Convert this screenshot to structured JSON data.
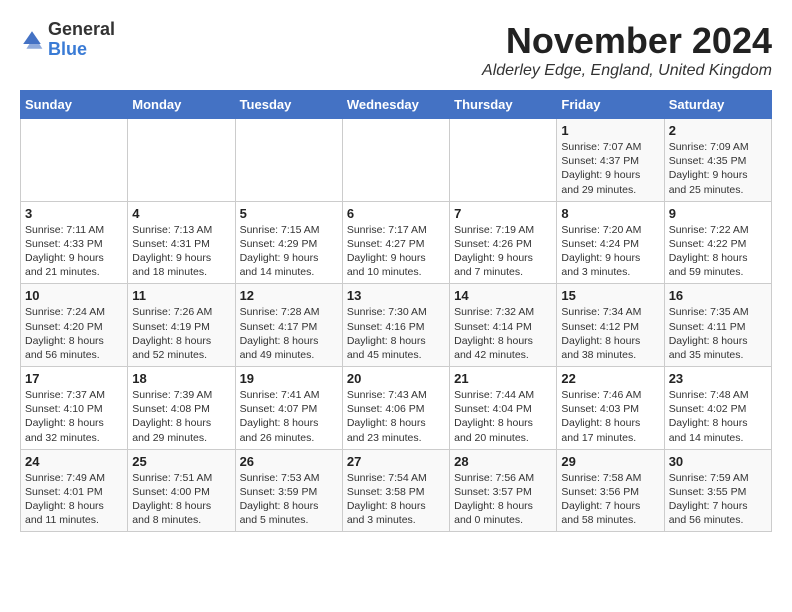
{
  "header": {
    "logo_general": "General",
    "logo_blue": "Blue",
    "title": "November 2024",
    "location": "Alderley Edge, England, United Kingdom"
  },
  "days_of_week": [
    "Sunday",
    "Monday",
    "Tuesday",
    "Wednesday",
    "Thursday",
    "Friday",
    "Saturday"
  ],
  "weeks": [
    [
      {
        "day": "",
        "info": ""
      },
      {
        "day": "",
        "info": ""
      },
      {
        "day": "",
        "info": ""
      },
      {
        "day": "",
        "info": ""
      },
      {
        "day": "",
        "info": ""
      },
      {
        "day": "1",
        "info": "Sunrise: 7:07 AM\nSunset: 4:37 PM\nDaylight: 9 hours and 29 minutes."
      },
      {
        "day": "2",
        "info": "Sunrise: 7:09 AM\nSunset: 4:35 PM\nDaylight: 9 hours and 25 minutes."
      }
    ],
    [
      {
        "day": "3",
        "info": "Sunrise: 7:11 AM\nSunset: 4:33 PM\nDaylight: 9 hours and 21 minutes."
      },
      {
        "day": "4",
        "info": "Sunrise: 7:13 AM\nSunset: 4:31 PM\nDaylight: 9 hours and 18 minutes."
      },
      {
        "day": "5",
        "info": "Sunrise: 7:15 AM\nSunset: 4:29 PM\nDaylight: 9 hours and 14 minutes."
      },
      {
        "day": "6",
        "info": "Sunrise: 7:17 AM\nSunset: 4:27 PM\nDaylight: 9 hours and 10 minutes."
      },
      {
        "day": "7",
        "info": "Sunrise: 7:19 AM\nSunset: 4:26 PM\nDaylight: 9 hours and 7 minutes."
      },
      {
        "day": "8",
        "info": "Sunrise: 7:20 AM\nSunset: 4:24 PM\nDaylight: 9 hours and 3 minutes."
      },
      {
        "day": "9",
        "info": "Sunrise: 7:22 AM\nSunset: 4:22 PM\nDaylight: 8 hours and 59 minutes."
      }
    ],
    [
      {
        "day": "10",
        "info": "Sunrise: 7:24 AM\nSunset: 4:20 PM\nDaylight: 8 hours and 56 minutes."
      },
      {
        "day": "11",
        "info": "Sunrise: 7:26 AM\nSunset: 4:19 PM\nDaylight: 8 hours and 52 minutes."
      },
      {
        "day": "12",
        "info": "Sunrise: 7:28 AM\nSunset: 4:17 PM\nDaylight: 8 hours and 49 minutes."
      },
      {
        "day": "13",
        "info": "Sunrise: 7:30 AM\nSunset: 4:16 PM\nDaylight: 8 hours and 45 minutes."
      },
      {
        "day": "14",
        "info": "Sunrise: 7:32 AM\nSunset: 4:14 PM\nDaylight: 8 hours and 42 minutes."
      },
      {
        "day": "15",
        "info": "Sunrise: 7:34 AM\nSunset: 4:12 PM\nDaylight: 8 hours and 38 minutes."
      },
      {
        "day": "16",
        "info": "Sunrise: 7:35 AM\nSunset: 4:11 PM\nDaylight: 8 hours and 35 minutes."
      }
    ],
    [
      {
        "day": "17",
        "info": "Sunrise: 7:37 AM\nSunset: 4:10 PM\nDaylight: 8 hours and 32 minutes."
      },
      {
        "day": "18",
        "info": "Sunrise: 7:39 AM\nSunset: 4:08 PM\nDaylight: 8 hours and 29 minutes."
      },
      {
        "day": "19",
        "info": "Sunrise: 7:41 AM\nSunset: 4:07 PM\nDaylight: 8 hours and 26 minutes."
      },
      {
        "day": "20",
        "info": "Sunrise: 7:43 AM\nSunset: 4:06 PM\nDaylight: 8 hours and 23 minutes."
      },
      {
        "day": "21",
        "info": "Sunrise: 7:44 AM\nSunset: 4:04 PM\nDaylight: 8 hours and 20 minutes."
      },
      {
        "day": "22",
        "info": "Sunrise: 7:46 AM\nSunset: 4:03 PM\nDaylight: 8 hours and 17 minutes."
      },
      {
        "day": "23",
        "info": "Sunrise: 7:48 AM\nSunset: 4:02 PM\nDaylight: 8 hours and 14 minutes."
      }
    ],
    [
      {
        "day": "24",
        "info": "Sunrise: 7:49 AM\nSunset: 4:01 PM\nDaylight: 8 hours and 11 minutes."
      },
      {
        "day": "25",
        "info": "Sunrise: 7:51 AM\nSunset: 4:00 PM\nDaylight: 8 hours and 8 minutes."
      },
      {
        "day": "26",
        "info": "Sunrise: 7:53 AM\nSunset: 3:59 PM\nDaylight: 8 hours and 5 minutes."
      },
      {
        "day": "27",
        "info": "Sunrise: 7:54 AM\nSunset: 3:58 PM\nDaylight: 8 hours and 3 minutes."
      },
      {
        "day": "28",
        "info": "Sunrise: 7:56 AM\nSunset: 3:57 PM\nDaylight: 8 hours and 0 minutes."
      },
      {
        "day": "29",
        "info": "Sunrise: 7:58 AM\nSunset: 3:56 PM\nDaylight: 7 hours and 58 minutes."
      },
      {
        "day": "30",
        "info": "Sunrise: 7:59 AM\nSunset: 3:55 PM\nDaylight: 7 hours and 56 minutes."
      }
    ]
  ]
}
